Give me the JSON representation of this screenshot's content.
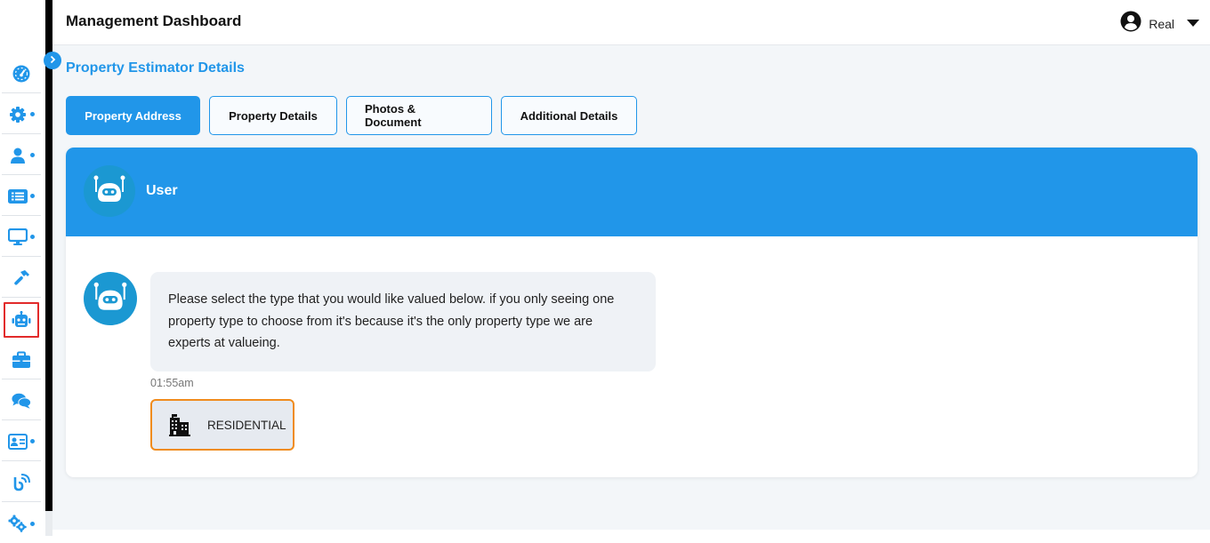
{
  "header": {
    "title": "Management Dashboard",
    "user_name": "Real",
    "user_icon": "user-circle-icon",
    "dropdown_icon": "caret-down-icon"
  },
  "sidebar": {
    "items": [
      {
        "name": "dashboard",
        "icon": "gauge-icon",
        "has_submenu": false,
        "active": false
      },
      {
        "name": "settings",
        "icon": "gear-icon",
        "has_submenu": true,
        "active": false
      },
      {
        "name": "users",
        "icon": "user-icon",
        "has_submenu": true,
        "active": false
      },
      {
        "name": "list",
        "icon": "list-icon",
        "has_submenu": true,
        "active": false
      },
      {
        "name": "display",
        "icon": "monitor-icon",
        "has_submenu": true,
        "active": false
      },
      {
        "name": "tools",
        "icon": "hammer-icon",
        "has_submenu": false,
        "active": false
      },
      {
        "name": "bot",
        "icon": "robot-icon",
        "has_submenu": false,
        "active": true
      },
      {
        "name": "jobs",
        "icon": "briefcase-icon",
        "has_submenu": false,
        "active": false
      },
      {
        "name": "chat",
        "icon": "comments-icon",
        "has_submenu": false,
        "active": false
      },
      {
        "name": "contacts",
        "icon": "id-card-icon",
        "has_submenu": true,
        "active": false
      },
      {
        "name": "integrations",
        "icon": "signal-icon",
        "has_submenu": false,
        "active": false
      },
      {
        "name": "advanced-settings",
        "icon": "gears-icon",
        "has_submenu": true,
        "active": false
      }
    ],
    "toggle_icon": "chevron-right-icon"
  },
  "page": {
    "section_title": "Property Estimator Details",
    "tabs": [
      {
        "label": "Property Address",
        "active": true
      },
      {
        "label": "Property Details",
        "active": false
      },
      {
        "label": "Photos & Document",
        "active": false
      },
      {
        "label": "Additional Details",
        "active": false
      }
    ]
  },
  "chat": {
    "header_name": "User",
    "messages": [
      {
        "sender": "bot",
        "text": "Please select the type that you would like valued below. if you only seeing one property type to choose from it's because it's the only property type we are experts at valueing.",
        "time": "01:55am"
      }
    ],
    "options": [
      {
        "label": "RESIDENTIAL",
        "icon": "building-icon"
      }
    ]
  },
  "colors": {
    "accent": "#2196e9",
    "avatar_bg": "#1b98d2",
    "option_border": "#f08c1d",
    "active_highlight": "#e22a2a"
  }
}
